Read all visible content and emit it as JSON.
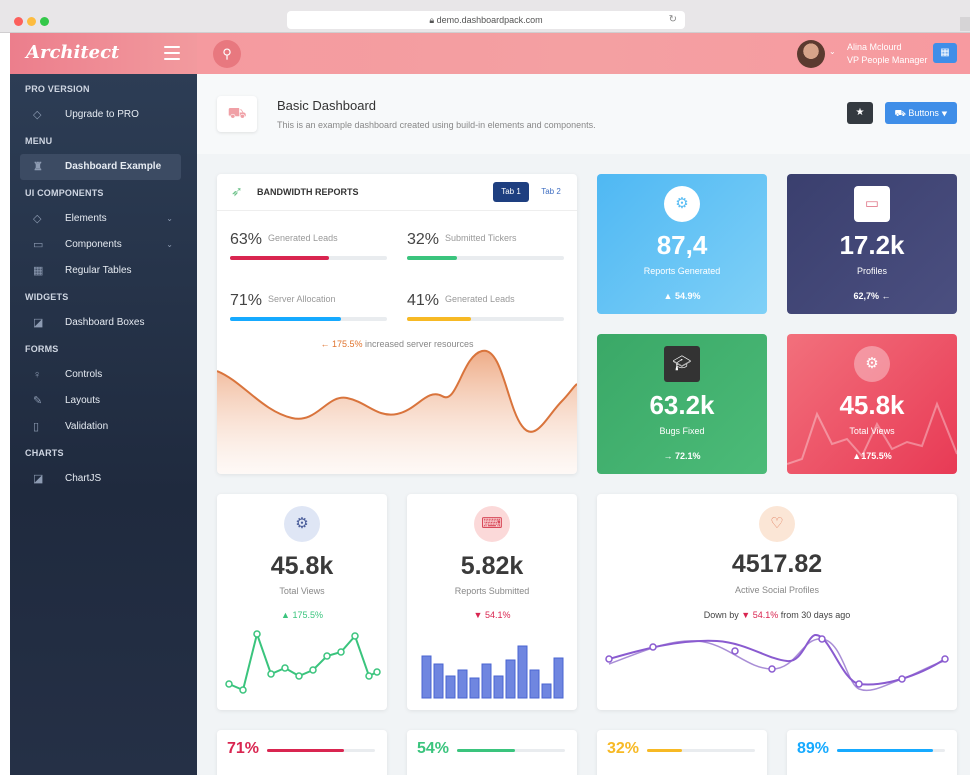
{
  "browser": {
    "url": "demo.dashboardpack.com"
  },
  "header": {
    "logo": "Architect",
    "user_name": "Alina Mclourd",
    "user_role": "VP People Manager"
  },
  "sidebar": {
    "sections": [
      {
        "title": "PRO VERSION",
        "items": [
          {
            "label": "Upgrade to PRO",
            "icon": "diamond-icon"
          }
        ]
      },
      {
        "title": "MENU",
        "items": [
          {
            "label": "Dashboard Example",
            "icon": "rocket-icon",
            "active": true
          }
        ]
      },
      {
        "title": "UI COMPONENTS",
        "items": [
          {
            "label": "Elements",
            "icon": "diamond-icon",
            "chevron": true
          },
          {
            "label": "Components",
            "icon": "car-icon",
            "chevron": true
          },
          {
            "label": "Regular Tables",
            "icon": "table-icon"
          }
        ]
      },
      {
        "title": "WIDGETS",
        "items": [
          {
            "label": "Dashboard Boxes",
            "icon": "chart-icon"
          }
        ]
      },
      {
        "title": "FORMS",
        "items": [
          {
            "label": "Controls",
            "icon": "lightbulb-icon"
          },
          {
            "label": "Layouts",
            "icon": "pencil-icon"
          },
          {
            "label": "Validation",
            "icon": "clipboard-icon"
          }
        ]
      },
      {
        "title": "CHARTS",
        "items": [
          {
            "label": "ChartJS",
            "icon": "chart-icon"
          }
        ]
      }
    ]
  },
  "page": {
    "title": "Basic Dashboard",
    "subtitle": "This is an example dashboard created using build-in elements and components.",
    "buttons_label": "Buttons"
  },
  "bandwidth": {
    "title": "BANDWIDTH REPORTS",
    "tab1": "Tab 1",
    "tab2": "Tab 2",
    "metrics": [
      {
        "pct": "63%",
        "label": "Generated Leads",
        "value": 0.63,
        "color": "#d92550"
      },
      {
        "pct": "32%",
        "label": "Submitted Tickers",
        "value": 0.32,
        "color": "#3ac47d"
      },
      {
        "pct": "71%",
        "label": "Server Allocation",
        "value": 0.71,
        "color": "#16aaff"
      },
      {
        "pct": "41%",
        "label": "Generated Leads",
        "value": 0.41,
        "color": "#f7b924"
      }
    ],
    "note_pct": "175.5%",
    "note_text": "increased server resources"
  },
  "tiles": [
    {
      "value": "87,4",
      "label": "Reports Generated",
      "trend": "54.9%",
      "arrow": "▲"
    },
    {
      "value": "17.2k",
      "label": "Profiles",
      "trend": "62,7%",
      "arrow": "←"
    },
    {
      "value": "63.2k",
      "label": "Bugs Fixed",
      "trend": "72.1%",
      "arrow": "→"
    },
    {
      "value": "45.8k",
      "label": "Total Views",
      "trend": "175.5%",
      "arrow": "▲"
    }
  ],
  "stats": [
    {
      "value": "45.8k",
      "label": "Total Views",
      "trend": "175.5%",
      "arrow": "▲",
      "trend_color": "#3ac47d"
    },
    {
      "value": "5.82k",
      "label": "Reports Submitted",
      "trend": "54.1%",
      "arrow": "▼",
      "trend_color": "#d92550"
    },
    {
      "value": "4517.82",
      "label": "Active Social Profiles",
      "trend_prefix": "Down by",
      "trend": "54.1%",
      "trend_suffix": "from 30 days ago",
      "arrow": "▼",
      "trend_color": "#d92550"
    }
  ],
  "bottom": [
    {
      "pct": "71%",
      "value": 0.71,
      "color": "#d92550"
    },
    {
      "pct": "54%",
      "value": 0.54,
      "color": "#3ac47d"
    },
    {
      "pct": "32%",
      "value": 0.32,
      "color": "#f7b924"
    },
    {
      "pct": "89%",
      "value": 0.89,
      "color": "#16aaff"
    }
  ]
}
